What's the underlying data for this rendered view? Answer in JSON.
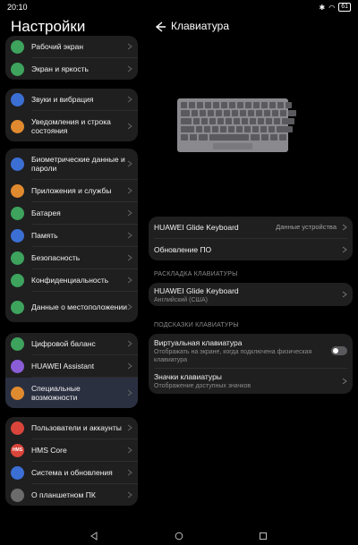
{
  "status": {
    "time": "20:10",
    "battery": "61"
  },
  "left": {
    "title": "Настройки",
    "groups": [
      [
        {
          "label": "Рабочий экран",
          "icon": "home-screen-icon",
          "color": "#3da35d"
        },
        {
          "label": "Экран и яркость",
          "icon": "display-icon",
          "color": "#3da35d"
        }
      ],
      [
        {
          "label": "Звуки и вибрация",
          "icon": "sound-icon",
          "color": "#3b6fd4"
        },
        {
          "label": "Уведомления и строка состояния",
          "icon": "notification-icon",
          "color": "#e08a2f"
        }
      ],
      [
        {
          "label": "Биометрические данные и пароли",
          "icon": "fingerprint-icon",
          "color": "#3b6fd4"
        },
        {
          "label": "Приложения и службы",
          "icon": "apps-icon",
          "color": "#e08a2f"
        },
        {
          "label": "Батарея",
          "icon": "battery-icon",
          "color": "#3da35d"
        },
        {
          "label": "Память",
          "icon": "storage-icon",
          "color": "#3b6fd4"
        },
        {
          "label": "Безопасность",
          "icon": "shield-icon",
          "color": "#3da35d"
        },
        {
          "label": "Конфиденциальность",
          "icon": "privacy-icon",
          "color": "#3da35d"
        },
        {
          "label": "Данные о местоположении",
          "icon": "location-icon",
          "color": "#3da35d"
        }
      ],
      [
        {
          "label": "Цифровой баланс",
          "icon": "digital-balance-icon",
          "color": "#3da35d"
        },
        {
          "label": "HUAWEI Assistant",
          "icon": "assistant-icon",
          "color": "#8a5cd6"
        },
        {
          "label": "Специальные возможности",
          "icon": "accessibility-icon",
          "color": "#e08a2f"
        }
      ],
      [
        {
          "label": "Пользователи и аккаунты",
          "icon": "user-icon",
          "color": "#d9453b"
        },
        {
          "label": "HMS Core",
          "icon": "hms-icon",
          "color": "#d9453b",
          "text": "HMS"
        },
        {
          "label": "Система и обновления",
          "icon": "system-icon",
          "color": "#3b6fd4"
        },
        {
          "label": "О планшетном ПК",
          "icon": "info-icon",
          "color": "#6b6b6b"
        }
      ]
    ]
  },
  "right": {
    "title": "Клавиатура",
    "group1": [
      {
        "label": "HUAWEI Glide Keyboard",
        "value": "Данные устройства"
      },
      {
        "label": "Обновление ПО",
        "value": ""
      }
    ],
    "section_layout": "РАСКЛАДКА КЛАВИАТУРЫ",
    "layout_item": {
      "label": "HUAWEI Glide Keyboard",
      "sub": "Английский (США)"
    },
    "section_hints": "ПОДСКАЗКИ КЛАВИАТУРЫ",
    "hints": [
      {
        "label": "Виртуальная клавиатура",
        "sub": "Отображать на экране, когда подключена физическая клавиатура",
        "toggle": false
      },
      {
        "label": "Значки клавиатуры",
        "sub": "Отображение доступных значков"
      }
    ]
  }
}
